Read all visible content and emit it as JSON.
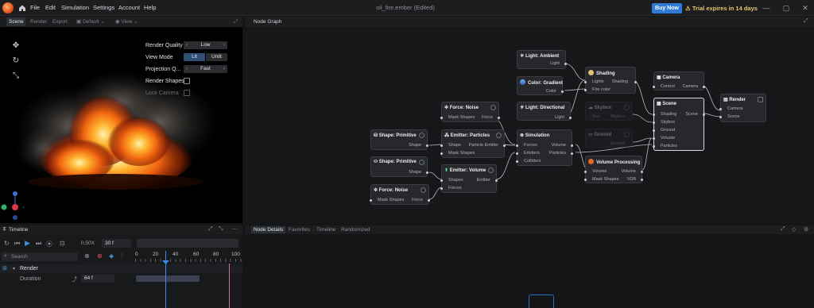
{
  "menubar": {
    "items": [
      "File",
      "Edit",
      "Simulation",
      "Settings",
      "Account",
      "Help"
    ],
    "doc_title": "oil_fire.ember (Edited)",
    "buy_label": "Buy Now",
    "trial_label": "Trial expires in 14 days"
  },
  "viewport": {
    "tabs": [
      "Scene",
      "Render",
      "Export"
    ],
    "active_tab": "Scene",
    "camera_select": "Default",
    "view_menu": "View",
    "render_settings": {
      "quality_label": "Render Quality",
      "quality_value": "Low",
      "view_mode_label": "View Mode",
      "lit": "Lit",
      "unlit": "Unlit",
      "projection_label": "Projection Q...",
      "projection_value": "Fast",
      "render_shapes_label": "Render Shapes",
      "lock_camera_label": "Lock Camera"
    }
  },
  "node_graph": {
    "title": "Node Graph",
    "nodes": {
      "light_ambient": {
        "title": "Light: Ambient",
        "out": "Light"
      },
      "color_gradient": {
        "title": "Color: Gradient",
        "out": "Color"
      },
      "light_directional": {
        "title": "Light: Directional",
        "out": "Light"
      },
      "shading": {
        "title": "Shading",
        "in1": "Lights",
        "in2": "Fire color",
        "out": "Shading"
      },
      "skybox": {
        "title": "Skybox",
        "in1": "Sun",
        "out": "Skybox"
      },
      "ground": {
        "title": "Ground",
        "out": "Ground"
      },
      "camera": {
        "title": "Camera",
        "in1": "Control",
        "out": "Camera"
      },
      "scene": {
        "title": "Scene",
        "in1": "Shading",
        "in2": "Skybox",
        "in3": "Ground",
        "in4": "Volume",
        "in5": "Particles",
        "out": "Scene"
      },
      "render": {
        "title": "Render",
        "in1": "Camera",
        "in2": "Scene"
      },
      "force_noise_1": {
        "title": "Force: Noise",
        "in1": "Mask Shapes",
        "out": "Force"
      },
      "shape_primitive_1": {
        "title": "Shape: Primitive",
        "out": "Shape"
      },
      "emitter_particles": {
        "title": "Emitter: Particles",
        "in1": "Shape",
        "in2": "Mask Shapes",
        "out": "Particle Emitter"
      },
      "simulation": {
        "title": "Simulation",
        "in1": "Forces",
        "in2": "Emitters",
        "in3": "Colliders",
        "out1": "Volume",
        "out2": "Particles"
      },
      "volume_processing": {
        "title": "Volume Processing",
        "in1": "Volume",
        "in2": "Mask Shapes",
        "out1": "Volume",
        "out2": "VDB"
      },
      "shape_primitive_2": {
        "title": "Shape: Primitive",
        "out": "Shape"
      },
      "emitter_volume": {
        "title": "Emitter: Volume",
        "in1": "Shapes",
        "in2": "Forces",
        "out": "Emitter"
      },
      "force_noise_2": {
        "title": "Force: Noise",
        "in1": "Mask Shapes",
        "out": "Force"
      }
    }
  },
  "timeline": {
    "title": "Timeline",
    "speed": "0.50X",
    "frame_rate": "30 f",
    "search_placeholder": "Search",
    "ruler": [
      "0",
      "20",
      "40",
      "60",
      "80",
      "100"
    ],
    "track_name": "Render",
    "property_name": "Duration",
    "property_value": "64 f"
  },
  "details": {
    "tabs": [
      "Node Details",
      "Favorites",
      "Timeline",
      "Randomized"
    ],
    "active_tab": "Node Details"
  },
  "colors": {
    "accent": "#2f7ad9",
    "trial": "#e9c36a",
    "playhead": "#3a8de8",
    "end_marker": "#d46aa8"
  }
}
